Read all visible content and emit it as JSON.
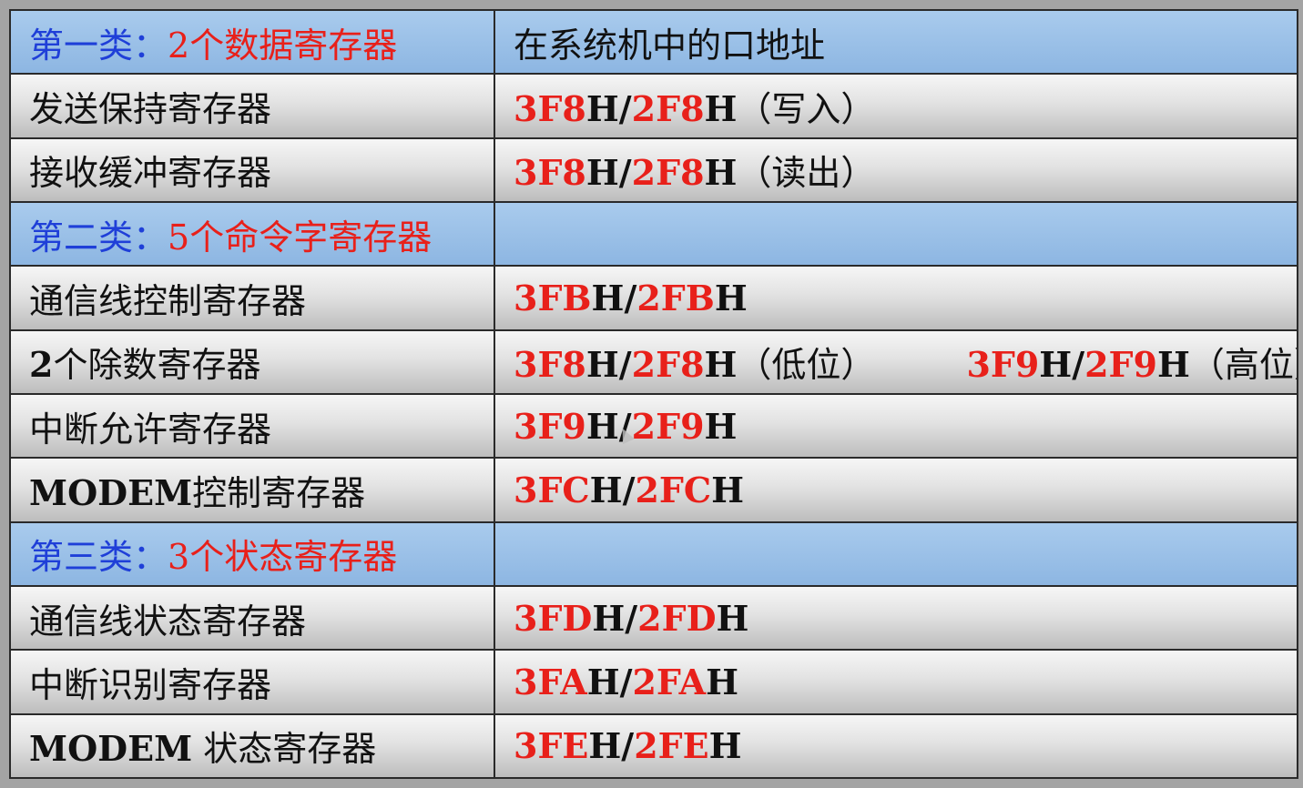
{
  "header": {
    "col1_prefix": "第一类：",
    "col1_count": "2个数据寄存器",
    "col2": "在系统机中的口地址"
  },
  "sections": [
    {
      "prefix": "第二类：",
      "title": "5个命令字寄存器"
    },
    {
      "prefix": "第三类：",
      "title": "3个状态寄存器"
    }
  ],
  "rows": {
    "r1": {
      "name": "发送保持寄存器",
      "a1": "3F8",
      "a2": "H/",
      "a3": "2F8",
      "a4": "H",
      "note": "（写入）"
    },
    "r2": {
      "name": "接收缓冲寄存器",
      "a1": "3F8",
      "a2": "H/",
      "a3": "2F8",
      "a4": "H",
      "note": "（读出）"
    },
    "r3": {
      "name": "通信线控制寄存器",
      "a1": "3FB",
      "a2": "H/",
      "a3": "2FB",
      "a4": "H"
    },
    "r4": {
      "name_prefix": "2",
      "name": "个除数寄存器",
      "a1": "3F8",
      "a2": "H/",
      "a3": "2F8",
      "a4": "H",
      "note": "（低位）",
      "b1": "3F9",
      "b2": "H/",
      "b3": "2F9",
      "b4": "H",
      "note2": "（高位）"
    },
    "r5": {
      "name": "中断允许寄存器",
      "a1": "3F9",
      "a2": "H/",
      "a3": "2F9",
      "a4": "H"
    },
    "r6": {
      "name_prefix": "MODEM",
      "name": "控制寄存器",
      "a1": "3FC",
      "a2": "H/",
      "a3": "2FC",
      "a4": "H"
    },
    "r7": {
      "name": "通信线状态寄存器",
      "a1": "3FD",
      "a2": "H/",
      "a3": "2FD",
      "a4": "H"
    },
    "r8": {
      "name": "中断识别寄存器",
      "a1": "3FA",
      "a2": "H/",
      "a3": "2FA",
      "a4": "H"
    },
    "r9": {
      "name_prefix": "MODEM",
      "name": " 状态寄存器",
      "a1": "3FE",
      "a2": "H/",
      "a3": "2FE",
      "a4": "H"
    }
  },
  "colors": {
    "header_bg": "#9dc2ea",
    "section_label": "#1f3fd8",
    "address_red": "#e8201a"
  }
}
